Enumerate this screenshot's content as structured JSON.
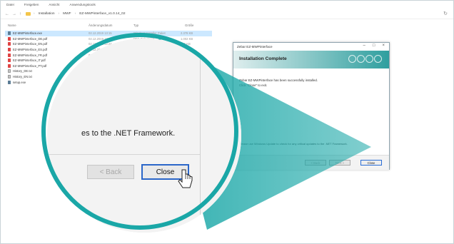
{
  "menu": [
    "Datei",
    "Freigeben",
    "Ansicht",
    "Anwendungstools"
  ],
  "address": {
    "crumbs": [
      "Installation",
      "MWF",
      "EZ-MWPinterface_v1.0.14_02"
    ],
    "separator": "›"
  },
  "columns": {
    "name": "Name",
    "date": "Änderungsdatum",
    "type": "Typ",
    "size": "Größe"
  },
  "files": [
    {
      "name": "EZ-MWPinterface.exe",
      "date": "02.12.2019 13:15",
      "type": "Windows Installer Paket",
      "size": "2.378 KB",
      "icon": "exe",
      "selected": true
    },
    {
      "name": "EZ-MWPinterface_DE.pdf",
      "date": "02.12.2019 12:24",
      "type": "PDF-Dokument",
      "size": "1.002 KB",
      "icon": "pdf"
    },
    {
      "name": "EZ-MWPinterface_EN.pdf",
      "date": "02.12.2019 12:24",
      "type": "PDF-Dokument",
      "size": "966 KB",
      "icon": "pdf"
    },
    {
      "name": "EZ-MWPinterface_ES.pdf",
      "date": "02.12.2019 12:24",
      "type": "PDF-Dokument",
      "size": "988 KB",
      "icon": "pdf"
    },
    {
      "name": "EZ-MWPinterface_FR.pdf",
      "date": "02.12.2019 12:24",
      "type": "PDF-Dokument",
      "size": "988 KB",
      "icon": "pdf"
    },
    {
      "name": "EZ-MWPinterface_IT.pdf",
      "date": "02.12.2019 12:24",
      "type": "PDF-Dokument",
      "size": "977 KB",
      "icon": "pdf"
    },
    {
      "name": "EZ-MWPinterface_PT.pdf",
      "date": "02.12.2019 12:24",
      "type": "PDF-Dokument",
      "size": "971 KB",
      "icon": "pdf"
    },
    {
      "name": "History_DE.txt",
      "date": "06.05.2019",
      "type": "",
      "size": "",
      "icon": "txt"
    },
    {
      "name": "History_EN.txt",
      "date": "06.05.2019",
      "type": "",
      "size": "",
      "icon": "txt"
    },
    {
      "name": "setup.exe",
      "date": "02.12.2019",
      "type": "",
      "size": "",
      "icon": "exe"
    }
  ],
  "installer": {
    "title": "Zebar EZ-MWPinterface",
    "header": "Installation Complete",
    "line1": "Zebar EZ-MWPinterface has been successfully installed.",
    "line2": "Click \"Close\" to exit.",
    "net_note": "Please use Windows Update to check for any critical updates to the .NET Framework.",
    "back_label": "< Back",
    "next_label": "Next >",
    "close_label": "Close"
  },
  "magnifier": {
    "text": "es to the .NET Framework.",
    "back_label": "< Back",
    "close_label": "Close"
  },
  "colors": {
    "accent": "#1aa7a7",
    "selection": "#cce8ff",
    "default_button": "#2b66c9"
  }
}
